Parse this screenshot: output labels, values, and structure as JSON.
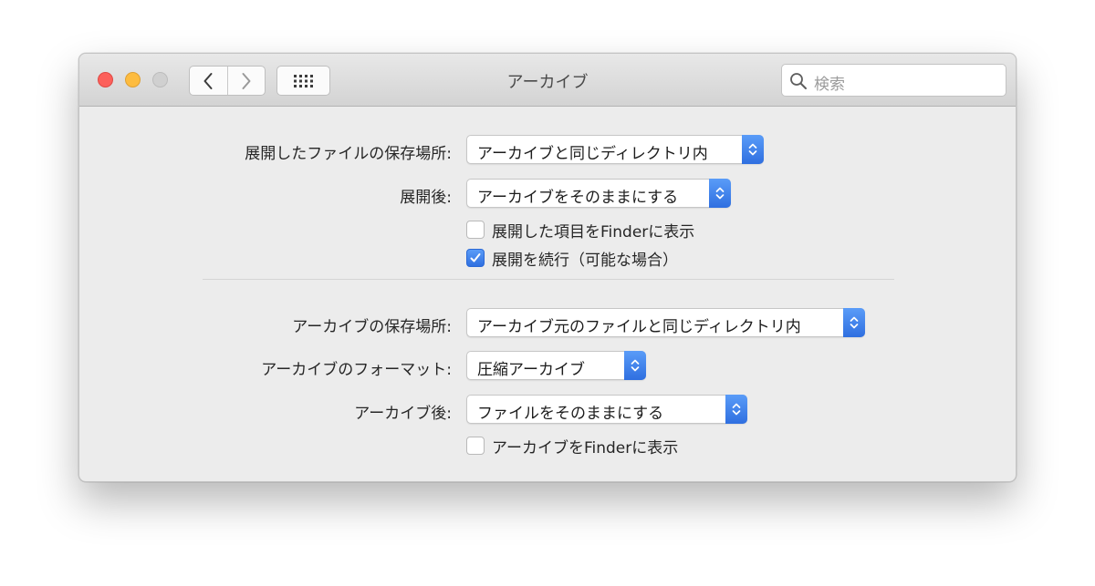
{
  "window": {
    "title": "アーカイブ",
    "search_placeholder": "検索"
  },
  "extract": {
    "location_label": "展開したファイルの保存場所:",
    "location_value": "アーカイブと同じディレクトリ内",
    "after_label": "展開後:",
    "after_value": "アーカイブをそのままにする",
    "reveal_label": "展開した項目をFinderに表示",
    "reveal_checked": false,
    "keep_expanding_label": "展開を続行（可能な場合）",
    "keep_expanding_checked": true
  },
  "archive": {
    "location_label": "アーカイブの保存場所:",
    "location_value": "アーカイブ元のファイルと同じディレクトリ内",
    "format_label": "アーカイブのフォーマット:",
    "format_value": "圧縮アーカイブ",
    "after_label": "アーカイブ後:",
    "after_value": "ファイルをそのままにする",
    "reveal_label": "アーカイブをFinderに表示",
    "reveal_checked": false
  },
  "colors": {
    "accent": "#3478f6",
    "close": "#fc605b",
    "minimize": "#fdbc40",
    "zoom_disabled": "#d0d0d0"
  },
  "icons": [
    "chevron-left-icon",
    "chevron-right-icon",
    "grid-icon",
    "search-icon",
    "stepper-icon",
    "checkmark-icon"
  ]
}
